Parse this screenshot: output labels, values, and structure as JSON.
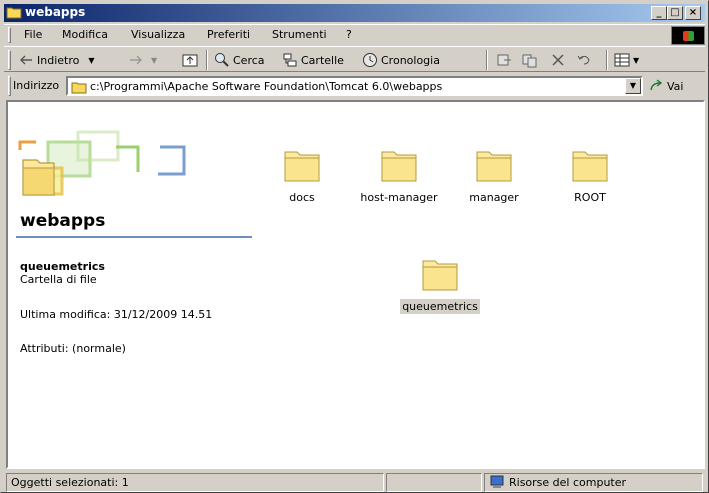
{
  "window": {
    "title": "webapps",
    "controls": {
      "minimize": "_",
      "maximize": "□",
      "close": "×"
    }
  },
  "menu": {
    "items": [
      "File",
      "Modifica",
      "Visualizza",
      "Preferiti",
      "Strumenti",
      "?"
    ]
  },
  "toolbar": {
    "back_label": "Indietro",
    "search_label": "Cerca",
    "folders_label": "Cartelle",
    "history_label": "Cronologia"
  },
  "address": {
    "label": "Indirizzo",
    "value": "c:\\Programmi\\Apache Software Foundation\\Tomcat 6.0\\webapps",
    "go_label": "Vai"
  },
  "panel": {
    "folder_title": "webapps",
    "selected_name": "queuemetrics",
    "selected_type": "Cartella di file",
    "modified": "Ultima modifica: 31/12/2009 14.51",
    "attributes": "Attributi: (normale)"
  },
  "folders": [
    {
      "name": "docs"
    },
    {
      "name": "host-manager"
    },
    {
      "name": "manager"
    },
    {
      "name": "ROOT"
    },
    {
      "name": "queuemetrics",
      "selected": true
    }
  ],
  "status": {
    "selected": "Oggetti selezionati: 1",
    "location": "Risorse del computer"
  },
  "colors": {
    "titlebar_start": "#0a246a",
    "titlebar_end": "#a6caf0",
    "chrome": "#d4d0c8",
    "folder_fill": "#fce79c",
    "folder_outline": "#b59a3a"
  }
}
